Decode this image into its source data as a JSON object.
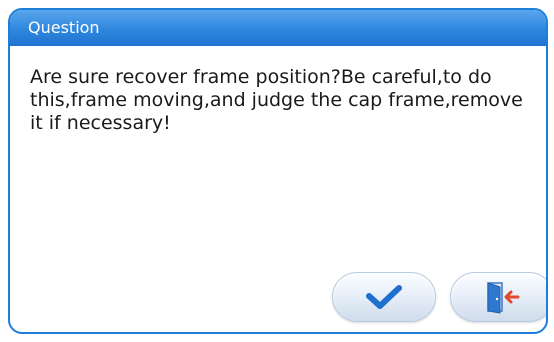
{
  "dialog": {
    "title": "Question",
    "message": "Are sure recover frame position?Be careful,to do this,frame moving,and judge the cap frame,remove it if necessary!"
  },
  "buttons": {
    "confirm_icon": "checkmark-icon",
    "exit_icon": "exit-door-icon"
  },
  "colors": {
    "title_bar": "#2f86dd",
    "border": "#1d7fd8",
    "checkmark": "#1e6fd0",
    "exit_arrow": "#e24a2f"
  }
}
